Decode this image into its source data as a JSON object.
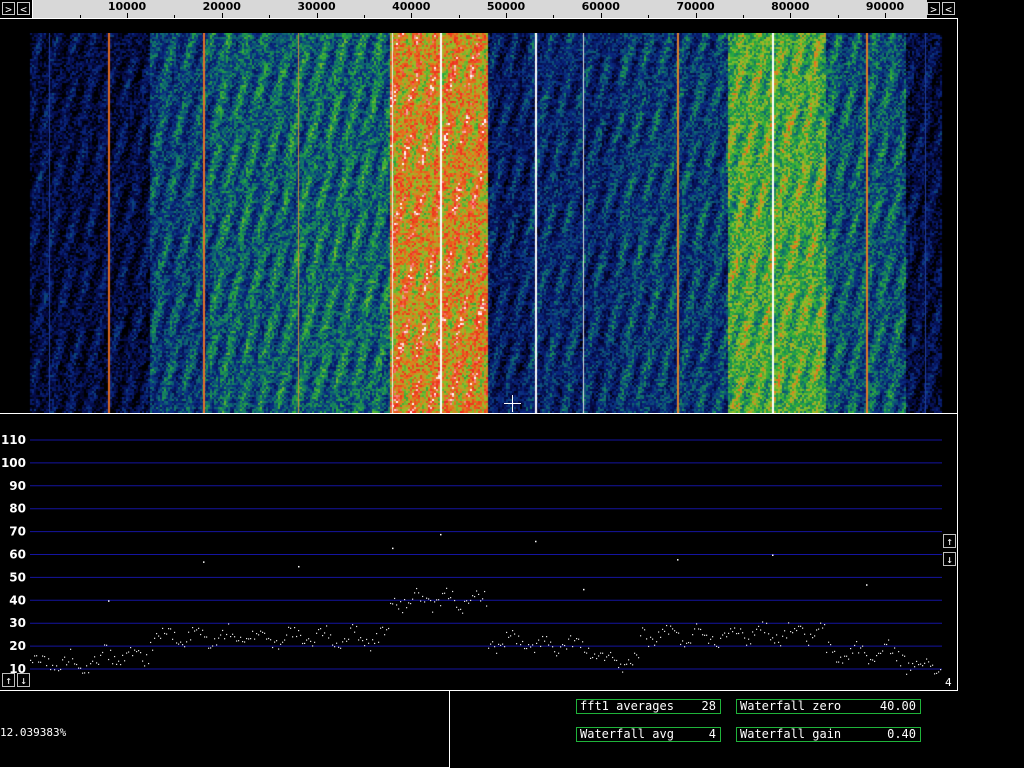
{
  "frequency_axis": {
    "labels": [
      "10000",
      "20000",
      "30000",
      "40000",
      "50000",
      "60000",
      "70000",
      "80000",
      "90000"
    ],
    "values": [
      10000,
      20000,
      30000,
      40000,
      50000,
      60000,
      70000,
      80000,
      90000
    ]
  },
  "buttons": {
    "scroll_left_outer": ">",
    "scroll_left_inner": "<",
    "scroll_right_outer": ">",
    "scroll_right_inner": "<",
    "spectrum_up": "↑",
    "spectrum_down": "↓",
    "level_up": "↑",
    "level_down": "↓"
  },
  "spectrum": {
    "y_labels": [
      "110",
      "100",
      "90",
      "80",
      "70",
      "60",
      "50",
      "40",
      "30",
      "20",
      "10"
    ],
    "average_count": "4"
  },
  "readout": {
    "percent": "12.039383%"
  },
  "parameters": {
    "fft1_averages": {
      "label": "fft1 averages",
      "value": "28"
    },
    "waterfall_avg": {
      "label": "Waterfall avg",
      "value": "4"
    },
    "waterfall_zero": {
      "label": "Waterfall zero",
      "value": "40.00"
    },
    "waterfall_gain": {
      "label": "Waterfall gain",
      "value": "0.40"
    }
  },
  "colors": {
    "grid": "#1414a0",
    "param_border": "#1fb33a"
  }
}
